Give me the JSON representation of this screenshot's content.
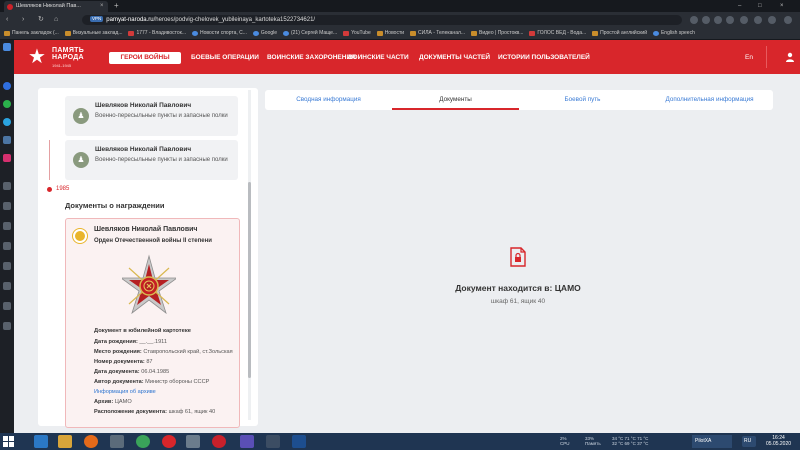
{
  "browser": {
    "tab_title": "Шевляков Николай Пав...",
    "tab_close": "×",
    "new_tab": "+",
    "url_badge": "VPN",
    "url_host": "pamyat-naroda.ru",
    "url_path": "/heroes/podvig-chelovek_yubileinaya_kartoteka1522734621/",
    "win_minimize": "–",
    "win_maximize": "□",
    "win_close": "×",
    "back": "‹",
    "forward": "›",
    "reload": "↻",
    "home": "⌂",
    "bookmarks": [
      "Панель закладок (...",
      "Визуальные заклад...",
      "1777 - Владивосток...",
      "Новости спорта, С...",
      "Google",
      "(21) Сергей Маще...",
      "YouTube",
      "Новости",
      "СИЛА - Телеканал...",
      "Видео | Простокв...",
      "ГОЛОС ВЕД - Вода...",
      "Простой английский",
      "English speech"
    ]
  },
  "site": {
    "logo_line1": "ПАМЯТЬ",
    "logo_line2": "НАРОДА",
    "logo_years": "1941-1945",
    "nav": {
      "heroes": "ГЕРОИ ВОЙНЫ",
      "operations": "БОЕВЫЕ ОПЕРАЦИИ",
      "burials": "ВОИНСКИЕ ЗАХОРОНЕНИЯ",
      "units": "ВОИНСКИЕ ЧАСТИ",
      "documents": "ДОКУМЕНТЫ ЧАСТЕЙ",
      "histories": "ИСТОРИИ ПОЛЬЗОВАТЕЛЕЙ"
    },
    "lang": "En"
  },
  "left": {
    "cards": [
      {
        "name": "Шевляков Николай Павлович",
        "sub": "Военно-пересыльные пункты и запасные полки"
      },
      {
        "name": "Шевляков Николай Павлович",
        "sub": "Военно-пересыльные пункты и запасные полки"
      }
    ],
    "year": "1985",
    "section_title": "Документы о награждении",
    "award": {
      "name": "Шевляков Николай Павлович",
      "title": "Орден Отечественной войны II степени",
      "doc_heading": "Документ в юбилейной картотеке",
      "rows": [
        {
          "label": "Дата рождения:",
          "value": "__.__.1911"
        },
        {
          "label": "Место рождения:",
          "value": "Ставропольский край, ст.Зольская"
        },
        {
          "label": "Номер документа:",
          "value": "87"
        },
        {
          "label": "Дата документа:",
          "value": "06.04.1985"
        },
        {
          "label": "Автор документа:",
          "value": "Министр обороны СССР"
        }
      ],
      "archive_link": "Информация об архиве",
      "archive_row": {
        "label": "Архив:",
        "value": "ЦАМО"
      },
      "location_row": {
        "label": "Расположение документа:",
        "value": "шкаф 61, ящик 40"
      }
    }
  },
  "right": {
    "tabs": [
      "Сводная информация",
      "Документы",
      "Боевой путь",
      "Дополнительная информация"
    ],
    "active_tab": 1,
    "doc_title": "Документ находится в: ЦАМО",
    "doc_sub": "шкаф 61, ящик 40"
  },
  "taskbar": {
    "tray_cpu": "2%",
    "tray_cpu_label": "CPU",
    "tray_ram": "33%",
    "tray_ram_label": "Память",
    "tray_temps": "34 °C   71 °C   71 °C",
    "tray_temps2": "32 °C   69 °C   37 °C",
    "active_app": "PilotXA",
    "lang": "RU",
    "time": "16:24",
    "date": "05.05.2020"
  },
  "colors": {
    "brand_red": "#d8262b",
    "link_blue": "#3a7bd5",
    "taskbar": "#1f3552"
  }
}
